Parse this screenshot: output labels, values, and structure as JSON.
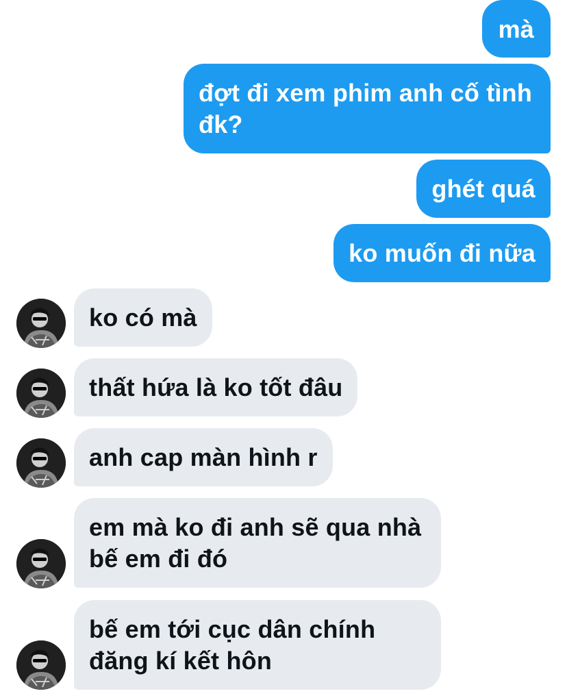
{
  "conversation": {
    "sent": [
      {
        "text": "mà"
      },
      {
        "text": "đợt đi xem phim anh cố tình đk?"
      },
      {
        "text": "ghét quá"
      },
      {
        "text": "ko muốn đi nữa"
      }
    ],
    "received": [
      {
        "text": "ko có mà",
        "avatar_icon": "user-avatar-icon"
      },
      {
        "text": "thất hứa là ko tốt đâu",
        "avatar_icon": "user-avatar-icon"
      },
      {
        "text": "anh cap màn hình r",
        "avatar_icon": "user-avatar-icon"
      },
      {
        "text": "em mà ko đi anh sẽ qua nhà bế em đi đó",
        "avatar_icon": "user-avatar-icon"
      },
      {
        "text": "bế em tới cục dân chính đăng kí kết hôn",
        "avatar_icon": "user-avatar-icon"
      }
    ]
  },
  "colors": {
    "sent_bubble": "#1d9bf0",
    "received_bubble": "#e7ebef",
    "sent_text": "#ffffff",
    "received_text": "#0f1419"
  }
}
